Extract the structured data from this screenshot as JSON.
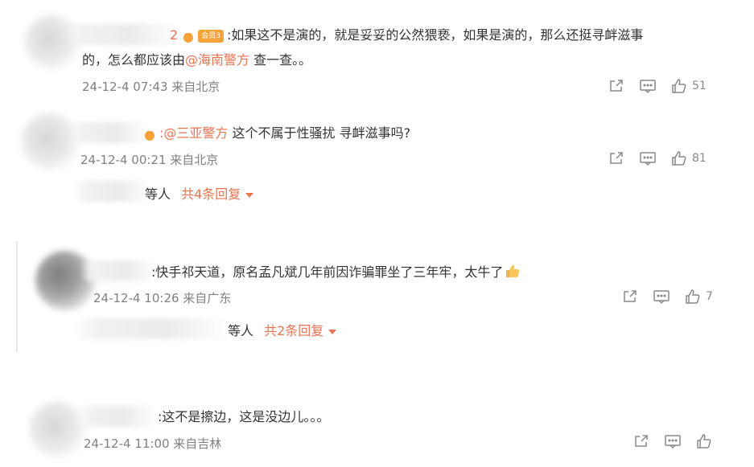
{
  "comments": [
    {
      "name_tail": "2",
      "badge": "会员3",
      "text_line1_a": ":如果这不是演的，就是妥妥的公然猥亵，如果是演的，那么还挺寻衅滋事",
      "text_line2_a": "的，怎么都应该由",
      "text_line2_mention": "@海南警方",
      "text_line2_b": " 查一查。。",
      "time": "24-12-4 07:43 来自北京",
      "likes": "51"
    },
    {
      "mention": ":@三亚警方",
      "text": " 这个不属于性骚扰 寻衅滋事吗?",
      "time": "24-12-4 00:21 来自北京",
      "likes": "81",
      "reply_prefix": "等人",
      "reply_link": "共4条回复"
    },
    {
      "text": ":快手祁天道，原名孟凡斌几年前因诈骗罪坐了三年牢，太牛了",
      "time": "24-12-4 10:26 来自广东",
      "likes": "7",
      "reply_prefix": "等人",
      "reply_link": "共2条回复"
    },
    {
      "text": ":这不是擦边，这是没边儿。。。",
      "time": "24-12-4 11:00 来自吉林",
      "likes": ""
    }
  ],
  "icons": {
    "share": "share-icon",
    "comment": "comment-icon",
    "like": "thumbs-up-icon",
    "dropdown": "caret-down-icon"
  },
  "colors": {
    "mention": "#eb7350",
    "meta": "#808080",
    "text": "#333333"
  }
}
